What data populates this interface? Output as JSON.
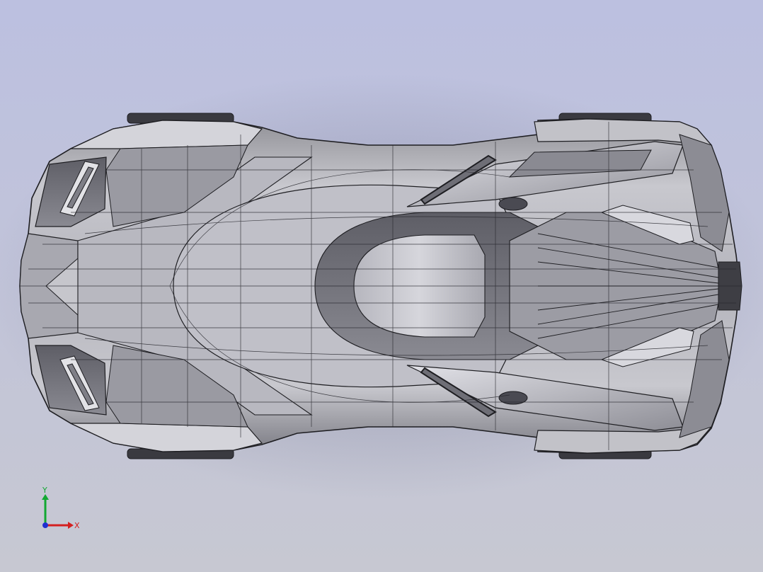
{
  "viewport": {
    "background_top": "#bcc0e0",
    "background_bottom": "#c7c8d2"
  },
  "model": {
    "shading_light": "#e4e4e8",
    "shading_mid": "#a2a2a8",
    "shading_dark": "#5a5a60",
    "edge_color": "#1e1e22"
  },
  "triad": {
    "x_label": "X",
    "y_label": "Y",
    "x_color": "#d42020",
    "y_color": "#12a832",
    "z_color": "#2030d0"
  }
}
